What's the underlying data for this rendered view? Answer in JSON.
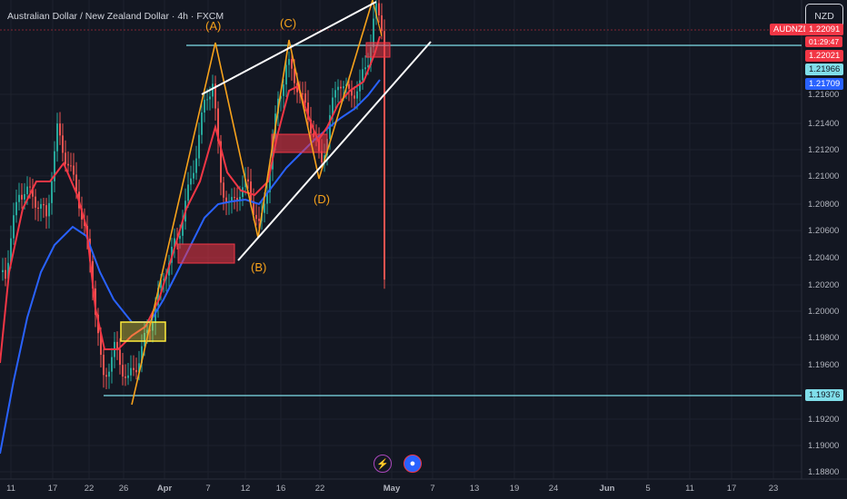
{
  "header": {
    "title": "Australian Dollar / New Zealand Dollar · 4h · FXCM",
    "currency_button": "NZD"
  },
  "price_axis": {
    "ticks": [
      "1.21600",
      "1.21400",
      "1.21200",
      "1.21000",
      "1.20800",
      "1.20600",
      "1.20400",
      "1.20200",
      "1.20000",
      "1.19800",
      "1.19600",
      "1.19200",
      "1.19000",
      "1.18800"
    ]
  },
  "time_axis": {
    "ticks": [
      "11",
      "17",
      "22",
      "26",
      "Apr",
      "7",
      "12",
      "16",
      "22",
      "May",
      "7",
      "13",
      "19",
      "24",
      "Jun",
      "5",
      "11",
      "17",
      "23"
    ]
  },
  "price_tags": {
    "symbol": "AUDNZD",
    "last_price": "1.22091",
    "countdown": "01:29:47",
    "price_red": "1.22021",
    "price_teal": "1.21966",
    "price_blue": "1.21709",
    "support_level": "1.19376"
  },
  "pattern_labels": {
    "a": "(A)",
    "b": "(B)",
    "c": "(C)",
    "d": "(D)"
  },
  "colors": {
    "background": "#131722",
    "bull": "#26a69a",
    "bear": "#ef5350",
    "ma_fast": "#f23645",
    "ma_slow": "#2962ff",
    "pattern": "#f7a21b",
    "hline": "#80deea",
    "zone_red": "#f23645",
    "zone_yellow": "#ffeb3b"
  },
  "icons": [
    "lightning-icon",
    "news-icon"
  ]
}
